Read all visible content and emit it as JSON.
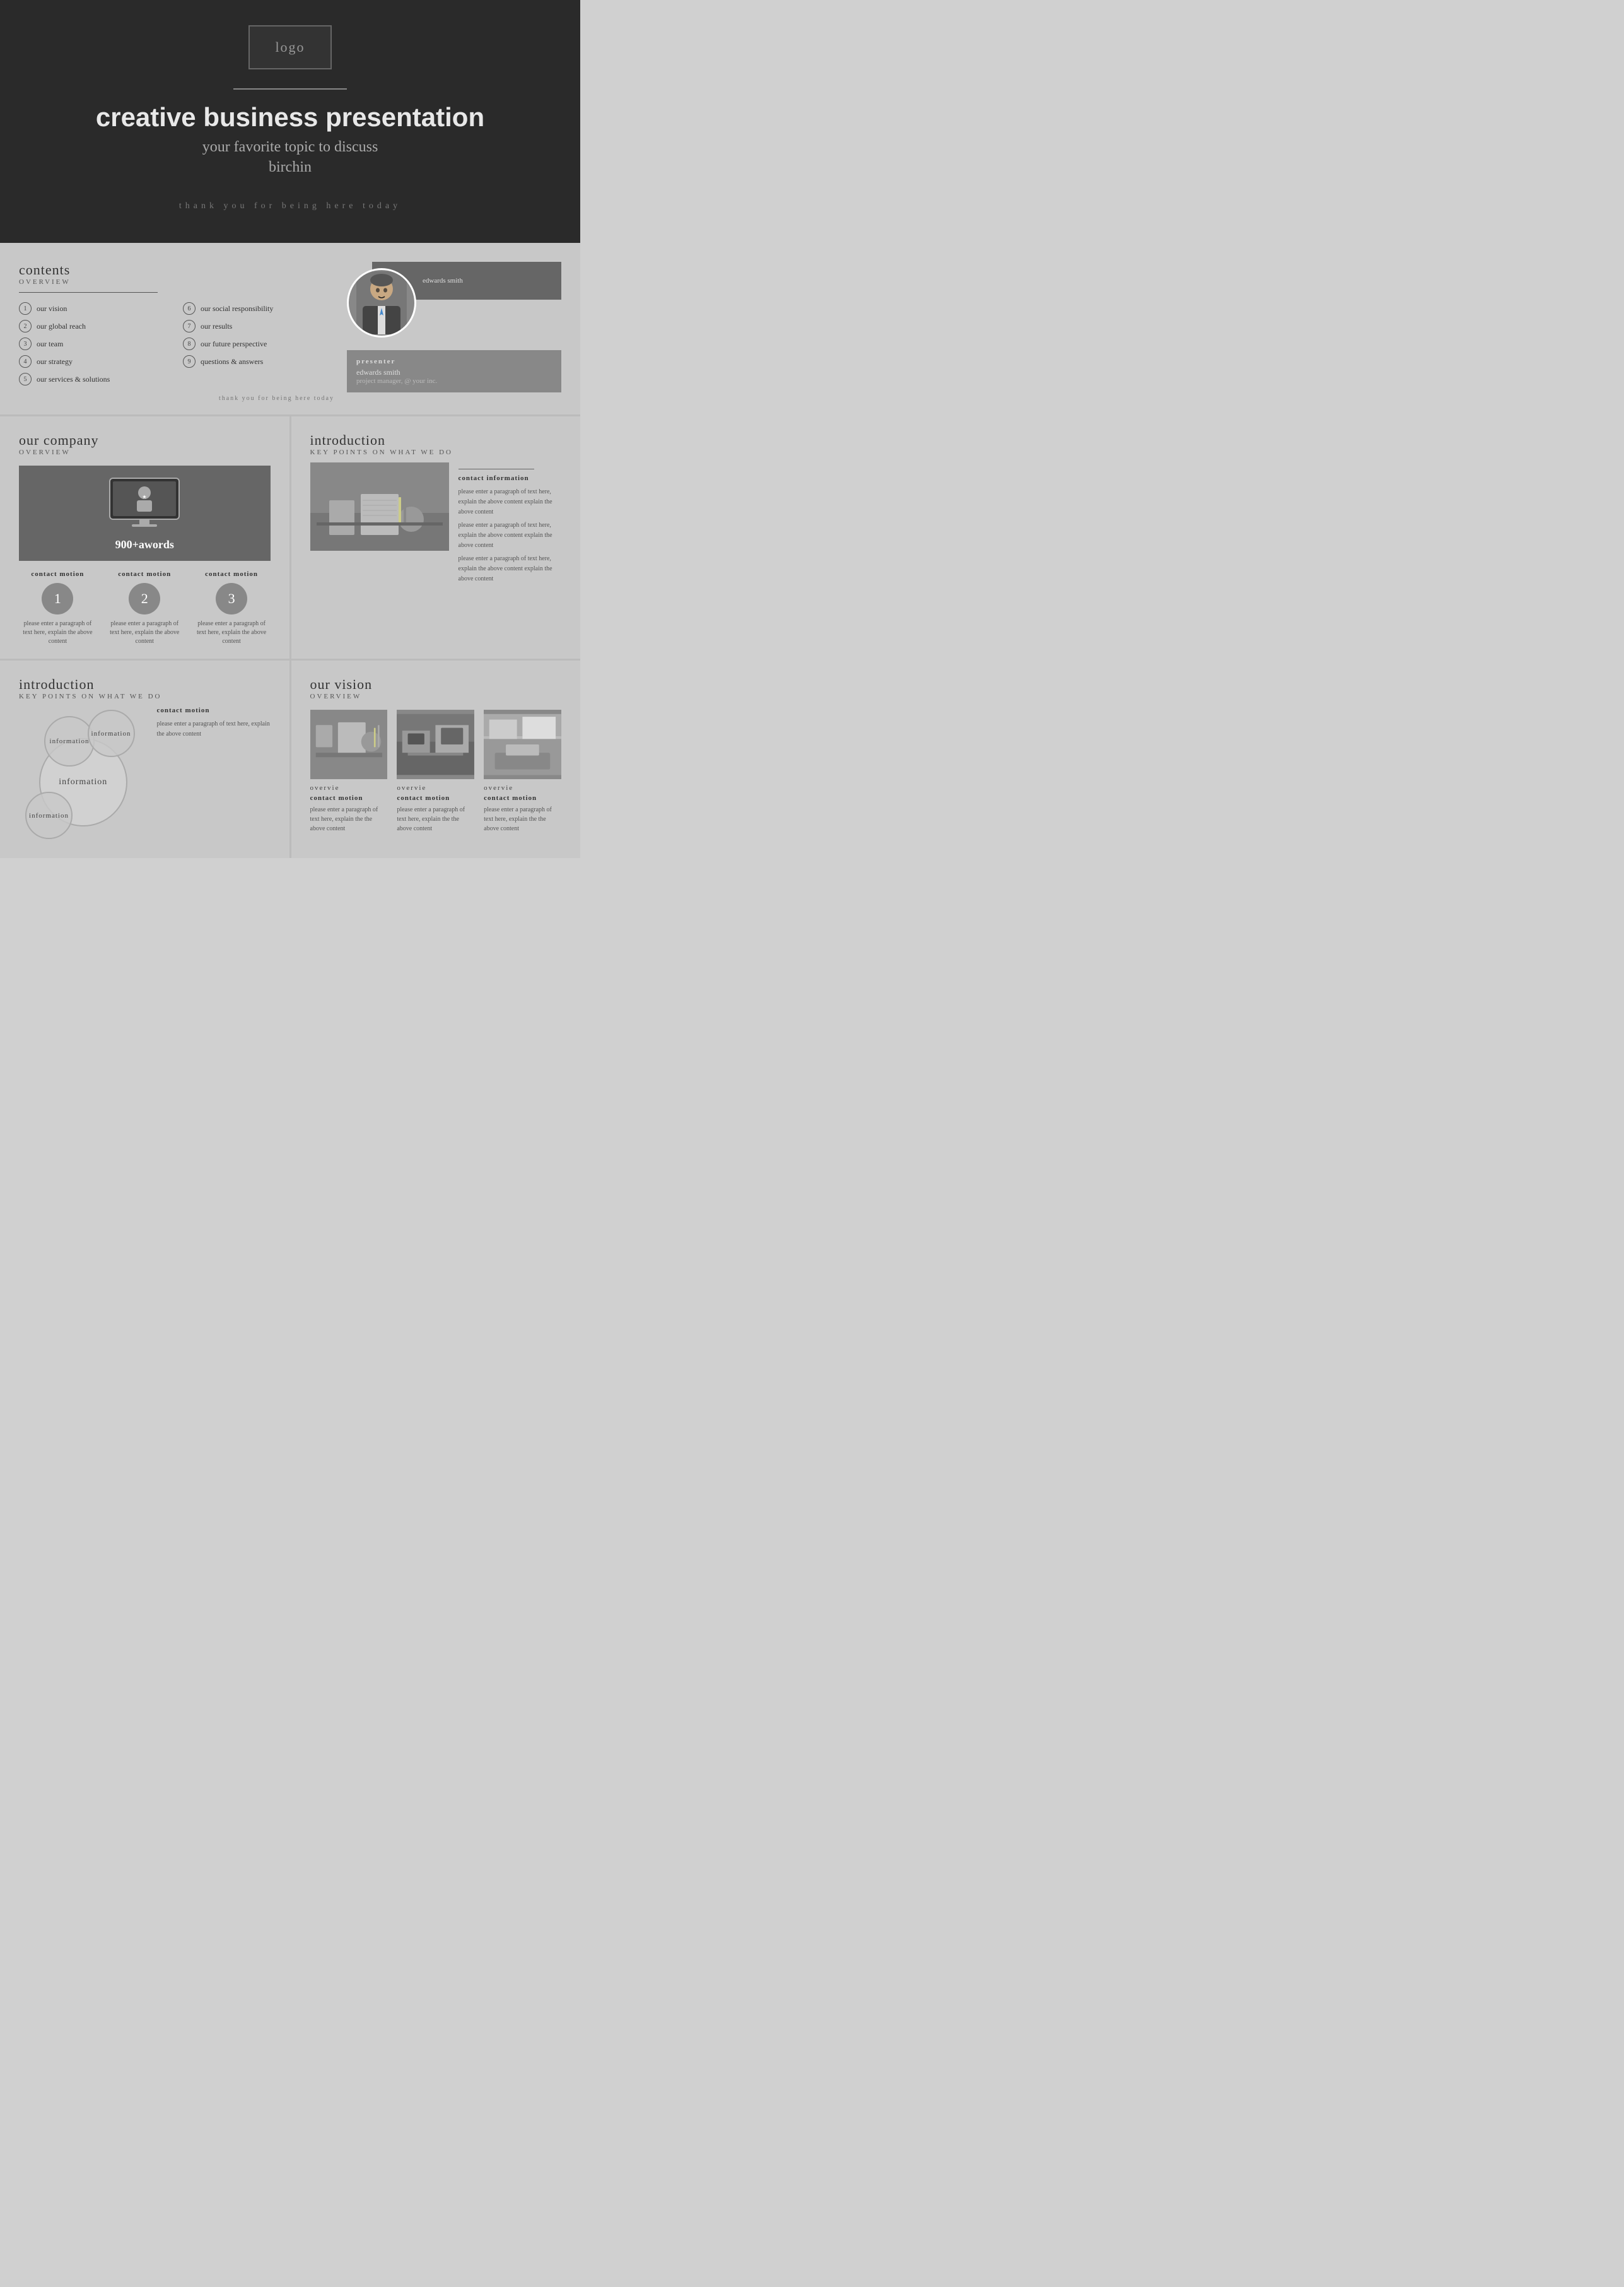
{
  "hero": {
    "logo": "logo",
    "divider": true,
    "title": "creative business presentation",
    "subtitle": "your favorite topic to discuss",
    "name": "birchin",
    "tagline": "thank you for being here today"
  },
  "contents": {
    "heading": "contents",
    "subheading": "overview",
    "toc": [
      {
        "num": "1",
        "label": "our vision"
      },
      {
        "num": "6",
        "label": "our social responsibility"
      },
      {
        "num": "2",
        "label": "our global reach"
      },
      {
        "num": "7",
        "label": "our results"
      },
      {
        "num": "3",
        "label": "our team"
      },
      {
        "num": "8",
        "label": "our future perspective"
      },
      {
        "num": "4",
        "label": "our strategy"
      },
      {
        "num": "9",
        "label": "questions & answers"
      },
      {
        "num": "5",
        "label": "our services & solutions"
      },
      {
        "num": "",
        "label": ""
      }
    ],
    "thank": "thank you for being here today"
  },
  "presenter": {
    "name": "edwards smith",
    "role": "presenter",
    "full_name": "edwards smith",
    "title": "project manager, @ your inc."
  },
  "company": {
    "heading": "our company",
    "subheading": "overview",
    "award": "900+awords",
    "contacts": [
      {
        "label": "contact motion",
        "num": "1",
        "desc": "please enter a paragraph of text here, explain the above content"
      },
      {
        "label": "contact motion",
        "num": "2",
        "desc": "please enter a paragraph of text here, explain the above content"
      },
      {
        "label": "contact motion",
        "num": "3",
        "desc": "please enter a paragraph of text here, explain the above content"
      }
    ]
  },
  "intro1": {
    "heading": "introduction",
    "subheading": "key points on what we do",
    "contact_info_label": "contact information",
    "paragraphs": [
      "please enter a paragraph of text here, explain the above content explain the above content",
      "please enter a paragraph of text here, explain the above content explain the above content",
      "please enter a paragraph of text here, explain the above content explain the above content"
    ]
  },
  "intro2": {
    "heading": "introduction",
    "subheading": "key points on what we do",
    "circles": [
      "information",
      "information",
      "information",
      "information"
    ],
    "contact_motion_label": "contact motion",
    "contact_motion_desc": "please enter a paragraph of text here, explain the above content"
  },
  "vision": {
    "heading": "our vision",
    "subheading": "overview",
    "cards": [
      {
        "overvie": "overvie",
        "title": "contact motion",
        "desc": "please enter a paragraph of text here, explain the the above content"
      },
      {
        "overvie": "overvie",
        "title": "contact motion",
        "desc": "please enter a paragraph of text here, explain the the above content"
      },
      {
        "overvie": "overvie",
        "title": "contact motion",
        "desc": "please enter a paragraph of text here, explain the the above content"
      }
    ]
  }
}
